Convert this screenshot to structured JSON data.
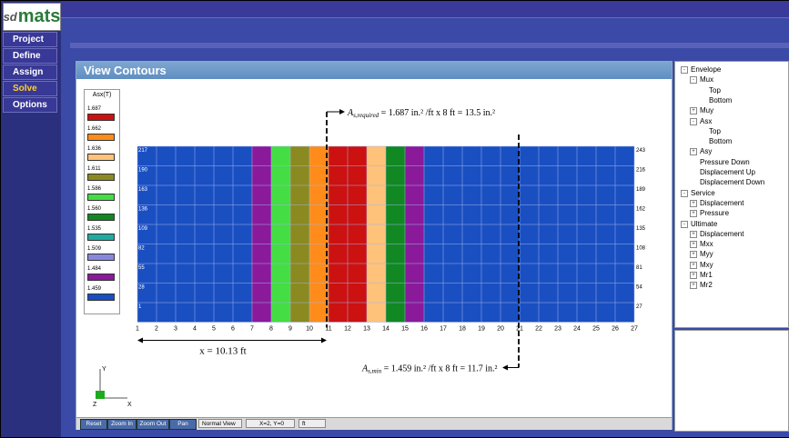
{
  "app": {
    "logo_prefix": "sd",
    "logo_main": "mats"
  },
  "menu": [
    {
      "label": "Project",
      "active": false
    },
    {
      "label": "Define",
      "active": false
    },
    {
      "label": "Assign",
      "active": false
    },
    {
      "label": "Solve",
      "active": true
    },
    {
      "label": "Options",
      "active": false
    }
  ],
  "panel": {
    "title": "View Contours"
  },
  "legend": {
    "title": "Asx(T)",
    "entries": [
      {
        "value": "1.687",
        "color": "#cc1111"
      },
      {
        "value": "1.662",
        "color": "#ff8c1a"
      },
      {
        "value": "1.636",
        "color": "#ffc27a"
      },
      {
        "value": "1.611",
        "color": "#8a8a20"
      },
      {
        "value": "1.586",
        "color": "#44dd44"
      },
      {
        "value": "1.560",
        "color": "#118822"
      },
      {
        "value": "1.535",
        "color": "#22aaa0"
      },
      {
        "value": "1.509",
        "color": "#8888dd"
      },
      {
        "value": "1.484",
        "color": "#8a1a9a"
      },
      {
        "value": "1.459",
        "color": "#1a4fc2"
      }
    ]
  },
  "annotations": {
    "required": {
      "lhs": "A",
      "sub": "s,required",
      "text": " = 1.687 in.² /ft x 8 ft = 13.5 in.²"
    },
    "min": {
      "lhs": "A",
      "sub": "s,min",
      "text": " = 1.459 in.² /ft x 8 ft = 11.7 in.²"
    },
    "distance": "x = 10.13 ft"
  },
  "grid": {
    "column_labels": [
      "1",
      "2",
      "3",
      "4",
      "5",
      "6",
      "7",
      "8",
      "9",
      "10",
      "11",
      "12",
      "13",
      "14",
      "15",
      "16",
      "17",
      "18",
      "19",
      "20",
      "21",
      "22",
      "23",
      "24",
      "25",
      "26",
      "27"
    ],
    "row_start_labels": [
      "217",
      "190",
      "163",
      "136",
      "109",
      "82",
      "55",
      "28",
      "1"
    ],
    "row_end_labels": [
      "243",
      "216",
      "189",
      "162",
      "135",
      "108",
      "81",
      "54",
      "27"
    ],
    "col_colors": [
      "#1a4fc2",
      "#1a4fc2",
      "#1a4fc2",
      "#1a4fc2",
      "#1a4fc2",
      "#1a4fc2",
      "#8a1a9a",
      "#44dd44",
      "#8a8a20",
      "#ff8c1a",
      "#cc1111",
      "#cc1111",
      "#ffc27a",
      "#118822",
      "#8a1a9a",
      "#1a4fc2",
      "#1a4fc2",
      "#1a4fc2",
      "#1a4fc2",
      "#1a4fc2",
      "#1a4fc2",
      "#1a4fc2",
      "#1a4fc2",
      "#1a4fc2",
      "#1a4fc2",
      "#1a4fc2"
    ]
  },
  "toolbar": {
    "buttons": [
      "Reset",
      "Zoom In",
      "Zoom Out",
      "Pan"
    ],
    "view_mode": "Normal View",
    "coords": "X=2, Y=0",
    "units": "ft"
  },
  "axis": {
    "y": "Y",
    "z": "Z",
    "x": "X"
  },
  "tree": [
    {
      "label": "Envelope",
      "box": "-",
      "depth": 0
    },
    {
      "label": "Mux",
      "box": "-",
      "depth": 1
    },
    {
      "label": "Top",
      "box": "",
      "depth": 2
    },
    {
      "label": "Bottom",
      "box": "",
      "depth": 2
    },
    {
      "label": "Muy",
      "box": "+",
      "depth": 1
    },
    {
      "label": "Asx",
      "box": "-",
      "depth": 1
    },
    {
      "label": "Top",
      "box": "",
      "depth": 2
    },
    {
      "label": "Bottom",
      "box": "",
      "depth": 2
    },
    {
      "label": "Asy",
      "box": "+",
      "depth": 1
    },
    {
      "label": "Pressure Down",
      "box": "",
      "depth": 1
    },
    {
      "label": "Displacement Up",
      "box": "",
      "depth": 1
    },
    {
      "label": "Displacement Down",
      "box": "",
      "depth": 1
    },
    {
      "label": "Service",
      "box": "-",
      "depth": 0
    },
    {
      "label": "Displacement",
      "box": "+",
      "depth": 1
    },
    {
      "label": "Pressure",
      "box": "+",
      "depth": 1
    },
    {
      "label": "Ultimate",
      "box": "-",
      "depth": 0
    },
    {
      "label": "Displacement",
      "box": "+",
      "depth": 1
    },
    {
      "label": "Mxx",
      "box": "+",
      "depth": 1
    },
    {
      "label": "Myy",
      "box": "+",
      "depth": 1
    },
    {
      "label": "Mxy",
      "box": "+",
      "depth": 1
    },
    {
      "label": "Mr1",
      "box": "+",
      "depth": 1
    },
    {
      "label": "Mr2",
      "box": "+",
      "depth": 1
    }
  ]
}
